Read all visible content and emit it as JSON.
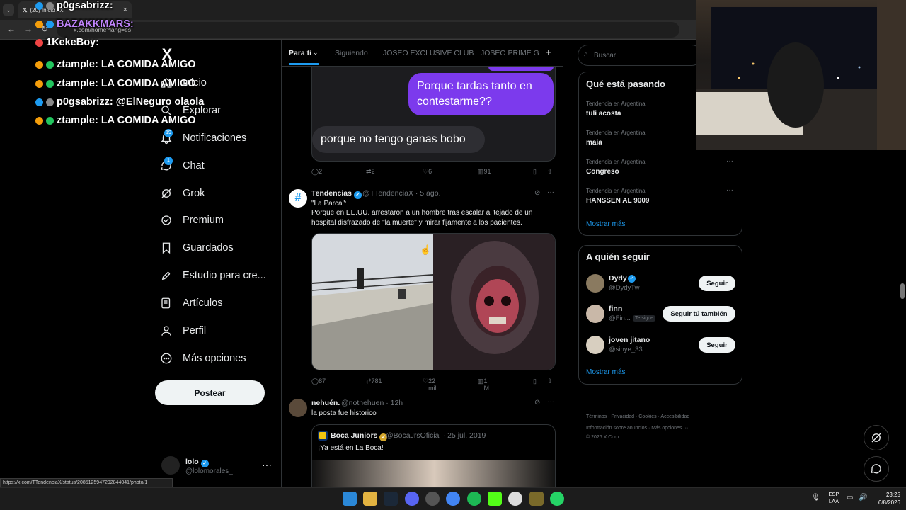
{
  "browser": {
    "tab_title": "(20) Inicio / X",
    "url": "x.com/home?lang=es",
    "status_url": "https://x.com/TTendenciaX/status/2085125947292844041/photo/1"
  },
  "chat": [
    {
      "user": "p0gsabrizz:",
      "text": "",
      "color": "#ffffff"
    },
    {
      "user": "BAZAKKMARS:",
      "text": "",
      "color": "#c084fc"
    },
    {
      "user": "1KekeBoy:",
      "text": "",
      "color": "#ffffff"
    },
    {
      "user": "ztample:",
      "text": "LA COMIDA AMIGO",
      "color": "#ffffff"
    },
    {
      "user": "ztample:",
      "text": "LA COMIDA AMIGO",
      "color": "#ffffff"
    },
    {
      "user": "p0gsabrizz:",
      "text": "@ElNeguro olaola",
      "color": "#ffffff"
    },
    {
      "user": "ztample:",
      "text": "LA COMIDA AMIGO",
      "color": "#ffffff"
    }
  ],
  "sidebar": {
    "logo": "X",
    "items": [
      {
        "label": "Inicio",
        "icon": "home-icon"
      },
      {
        "label": "Explorar",
        "icon": "search-icon"
      },
      {
        "label": "Notificaciones",
        "icon": "bell-icon",
        "badge": "19"
      },
      {
        "label": "Chat",
        "icon": "chat-icon",
        "badge": "1"
      },
      {
        "label": "Grok",
        "icon": "grok-icon"
      },
      {
        "label": "Premium",
        "icon": "premium-icon"
      },
      {
        "label": "Guardados",
        "icon": "bookmark-icon"
      },
      {
        "label": "Estudio para cre...",
        "icon": "rocket-icon"
      },
      {
        "label": "Artículos",
        "icon": "article-icon"
      },
      {
        "label": "Perfil",
        "icon": "person-icon"
      },
      {
        "label": "Más opciones",
        "icon": "more-circle-icon"
      }
    ],
    "post_label": "Postear",
    "account": {
      "name": "lolo",
      "handle": "@lolomorales_"
    }
  },
  "feed_tabs": [
    "Para ti",
    "Siguiendo",
    "JOSEO EXCLUSIVE CLUB",
    "JOSEO PRIME GR"
  ],
  "tweet1": {
    "bubble_right": "Porque tardas tanto en contestarme??",
    "bubble_left": "porque no tengo ganas bobo",
    "replies": "2",
    "reposts": "2",
    "likes": "6",
    "views": "91"
  },
  "tweet2": {
    "name": "Tendencias",
    "handle": "@TTendenciaX",
    "time": "· 5 ago.",
    "line1": "\"La Parca\":",
    "line2": "Porque en EE.UU. arrestaron a un hombre tras escalar al tejado de un hospital disfrazado de \"la muerte\" y mirar fijamente a los pacientes.",
    "replies": "87",
    "reposts": "781",
    "likes": "22 mil",
    "views": "1 M"
  },
  "tweet3": {
    "name": "nehuén.",
    "handle": "@notnehuen",
    "time": "· 12h",
    "text": "la posta fue historico",
    "quote": {
      "name": "Boca Juniors",
      "handle": "@BocaJrsOficial",
      "time": "· 25 jul. 2019",
      "text": "¡Ya está en La Boca!"
    }
  },
  "right": {
    "search_placeholder": "Buscar",
    "trends_title": "Qué está pasando",
    "trends": [
      {
        "context": "Tendencia en Argentina",
        "name": "tuli acosta"
      },
      {
        "context": "Tendencia en Argentina",
        "name": "maia"
      },
      {
        "context": "Tendencia en Argentina",
        "name": "Congreso"
      },
      {
        "context": "Tendencia en Argentina",
        "name": "HANSSEN AL 9009"
      }
    ],
    "show_more": "Mostrar más",
    "follow_title": "A quién seguir",
    "follow": [
      {
        "name": "Dydy",
        "handle": "@DydyTw",
        "button": "Seguir"
      },
      {
        "name": "finn",
        "handle": "@Fin...",
        "tag": "Te sigue",
        "button": "Seguir tú también"
      },
      {
        "name": "joven jitano",
        "handle": "@sinye_33",
        "button": "Seguir"
      }
    ],
    "follow_more": "Mostrar más",
    "footer1": "Términos  ·  Privacidad  ·  Cookies  ·  Accesibilidad  ·",
    "footer2": "Información sobre anuncios  ·  Más opciones ···",
    "footer3": "© 2026 X Corp."
  },
  "taskbar": {
    "lang1": "ESP",
    "lang2": "LAA",
    "time": "23:25",
    "date": "6/8/2026"
  },
  "colors": {
    "accent": "#1d9bf0",
    "bubble_purple": "#7c3aed",
    "background": "#000000"
  }
}
